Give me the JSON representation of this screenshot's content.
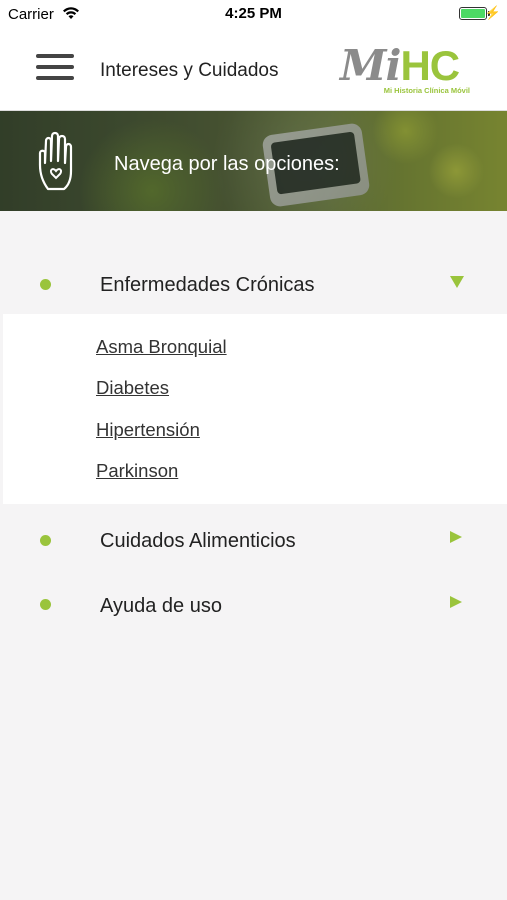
{
  "status_bar": {
    "carrier": "Carrier",
    "time": "4:25 PM"
  },
  "header": {
    "title": "Intereses y Cuidados",
    "logo": {
      "mi": "Mi",
      "hc": "HC",
      "subtitle": "Mi Historia Clínica Móvil"
    }
  },
  "banner": {
    "text": "Navega por las opciones:"
  },
  "menu": {
    "items": [
      {
        "label": "Enfermedades Crónicas",
        "expanded": true
      },
      {
        "label": "Cuidados Alimenticios",
        "expanded": false
      },
      {
        "label": "Ayuda de uso",
        "expanded": false
      }
    ],
    "submenu": [
      "Asma Bronquial",
      "Diabetes",
      "Hipertensión",
      "Parkinson"
    ]
  },
  "colors": {
    "accent": "#9ac43c",
    "background": "#f5f4f5",
    "header_bg": "#ffffff"
  }
}
